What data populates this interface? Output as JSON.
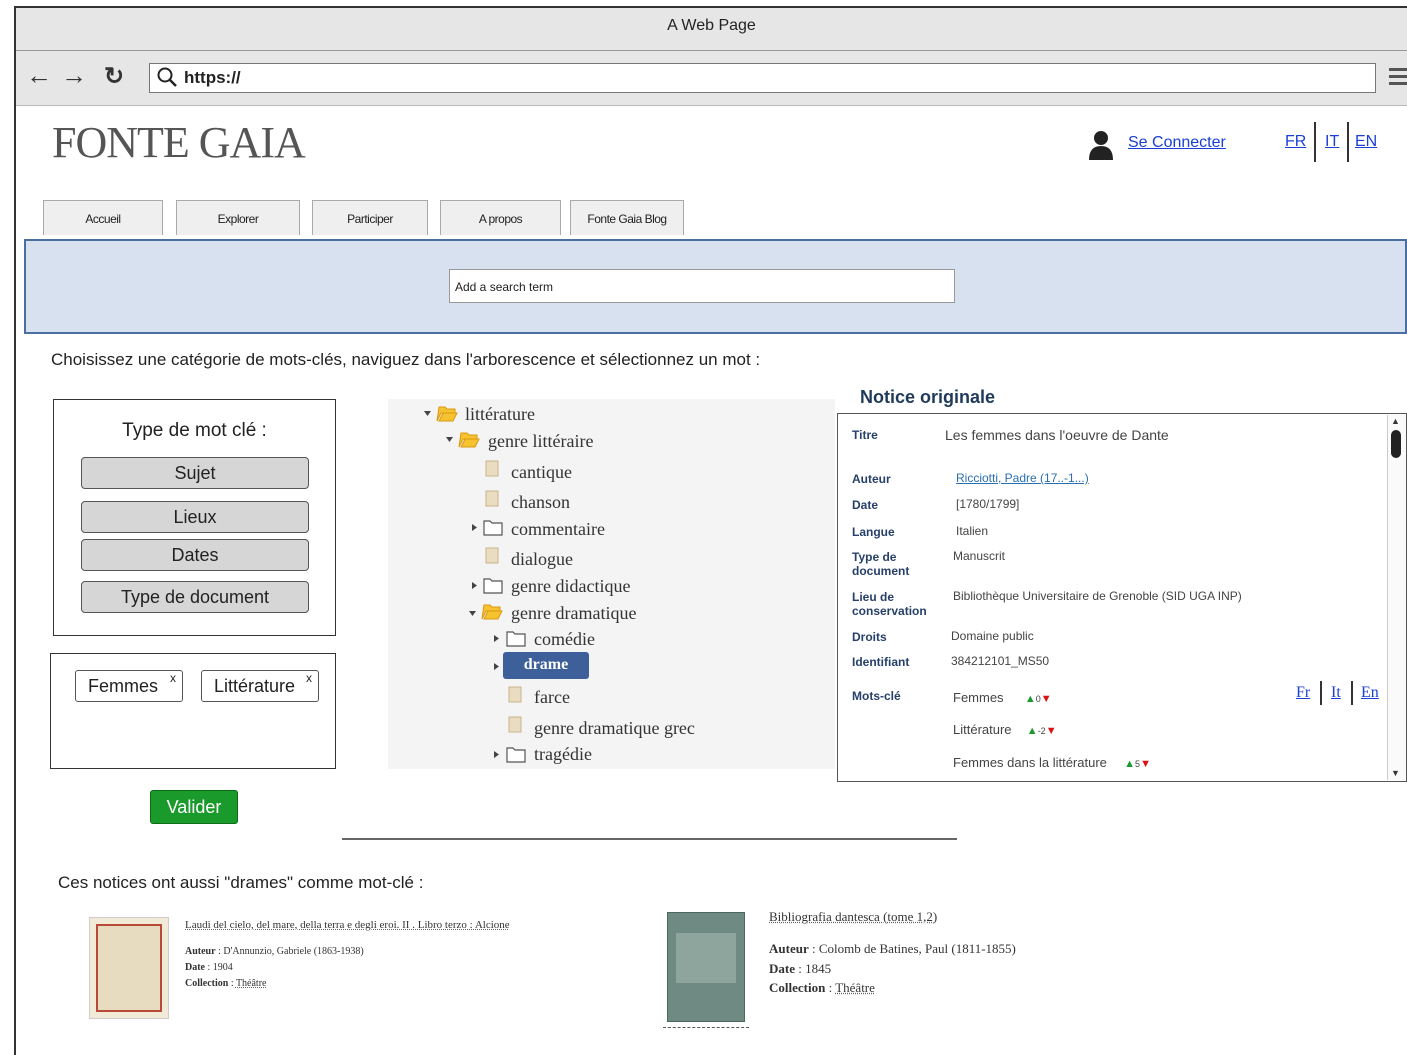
{
  "browser": {
    "title": "A Web Page",
    "url": "https://"
  },
  "header": {
    "logo": "FONTE GAIA",
    "connect": "Se Connecter",
    "langs": [
      "FR",
      "IT",
      "EN"
    ]
  },
  "tabs": [
    "Accueil",
    "Explorer",
    "Participer",
    "A propos",
    "Fonte Gaia Blog"
  ],
  "search": {
    "placeholder": "Add a search term"
  },
  "instruction": "Choisissez une catégorie de mots-clés, naviguez dans l'arborescence et sélectionnez un mot :",
  "keyword_type": {
    "title": "Type de mot clé :",
    "buttons": [
      "Sujet",
      "Lieux",
      "Dates",
      "Type de document"
    ]
  },
  "selected": {
    "chips": [
      "Femmes",
      "Littérature"
    ],
    "remove": "x"
  },
  "validate": "Valider",
  "tree": {
    "nodes": [
      "littérature",
      "genre littéraire",
      "cantique",
      "chanson",
      "commentaire",
      "dialogue",
      "genre didactique",
      "genre dramatique",
      "comédie",
      "drame",
      "farce",
      "genre dramatique grec",
      "tragédie"
    ]
  },
  "notice": {
    "heading": "Notice originale",
    "titre_label": "Titre",
    "titre": "Les femmes dans l'oeuvre de Dante",
    "auteur_label": "Auteur",
    "auteur": "Ricciotti, Padre (17..-1...)",
    "date_label": "Date",
    "date": "[1780/1799]",
    "langue_label": "Langue",
    "langue": "Italien",
    "type_label": "Type de document",
    "type": "Manuscrit",
    "lieu_label": "Lieu de conservation",
    "lieu": "Bibliothèque Universitaire de Grenoble (SID UGA INP)",
    "droits_label": "Droits",
    "droits": "Domaine public",
    "id_label": "Identifiant",
    "id": "384212101_MS50",
    "mots_label": "Mots-clé",
    "keywords": [
      {
        "word": "Femmes",
        "count": "0"
      },
      {
        "word": "Littérature",
        "count": "-2"
      },
      {
        "word": "Femmes dans la littérature",
        "count": "5"
      }
    ],
    "langs": [
      "Fr",
      "It",
      "En"
    ]
  },
  "also": {
    "heading": "Ces notices ont aussi \"drames\" comme mot-clé :",
    "records": [
      {
        "title": "Laudi del cielo, del mare, della terra e degli eroi. II . Libro terzo : Alcione",
        "auteur": "D'Annunzio, Gabriele (1863-1938)",
        "date": "1904",
        "collection": "Théâtre"
      },
      {
        "title": "Bibliografia dantesca (tome 1,2)",
        "auteur": "Colomb de Batines, Paul (1811-1855)",
        "date": "1845",
        "collection": "Théâtre"
      }
    ],
    "labels": {
      "auteur": "Auteur",
      "date": "Date",
      "collection": "Collection"
    }
  },
  "colors": {
    "accent": "#3d5f9a",
    "validate": "#1a9a2a",
    "search_bg": "#d7e1f0",
    "link": "#1a3fd6"
  }
}
